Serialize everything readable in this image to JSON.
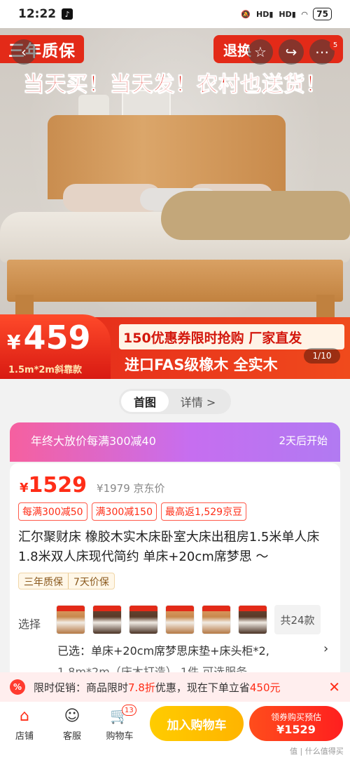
{
  "status_bar": {
    "time": "12:22",
    "battery": "75",
    "signal1": "HD",
    "signal2": "HD"
  },
  "hero": {
    "warranty_tag": "三年质保",
    "return_tag": "退换",
    "slogan": "当天买！当天发！农村也送货！",
    "price_currency": "¥",
    "price": "459",
    "price_sub": "1.5m*2m斜靠款",
    "coupon_line": "150优惠券限时抢购  厂家直发",
    "fas_line": "进口FAS级橡木  全实木",
    "pager": "1/10",
    "share_badge": "5"
  },
  "tabs": [
    {
      "label": "首图"
    },
    {
      "label": "详情 >"
    }
  ],
  "promo": {
    "left": "年终大放价每满300减40",
    "right": "2天后开始"
  },
  "product": {
    "currency": "¥",
    "price": "1529",
    "original_price": "¥1979 京东价",
    "chips": [
      "每满300减50",
      "满300减150",
      "最高返1,529京豆"
    ],
    "title": "汇尔聚财床 橡胶木实木床卧室大床出租房1.5米单人床1.8米双人床现代简约 单床+20cm席梦思 〜",
    "tags": [
      "三年质保",
      "7天价保"
    ]
  },
  "selection": {
    "label": "选择",
    "total": "共24款",
    "selected": "已选：单床+20cm席梦思床垫+床头柜*2,",
    "selected_more": "1.8m*2m（床木打造）   1件  可选服务"
  },
  "limit_bar": {
    "icon_text": "%",
    "prefix": "限时促销：商品限时",
    "discount": "7.8折",
    "middle": "优惠，现在下单立省",
    "save": "450元"
  },
  "bottom_bar": {
    "shop": "店铺",
    "service": "客服",
    "cart": "购物车",
    "cart_count": "13",
    "add_to_cart": "加入购物车",
    "buy_line1": "领券购买预估",
    "buy_line2": "¥1529"
  },
  "watermark": "值 | 什么值得买"
}
